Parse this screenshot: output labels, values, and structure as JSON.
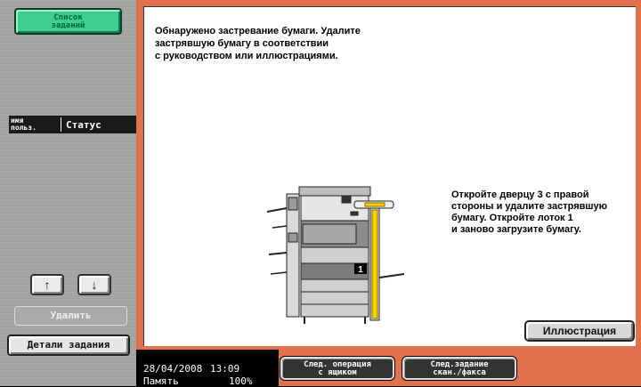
{
  "sidebar": {
    "job_list_label": "Список\nзаданий",
    "column_user": "имя\nпольз.",
    "column_status": "Статус",
    "up_arrow": "↑",
    "down_arrow": "↓",
    "delete_label": "Удалить",
    "details_label": "Детали задания"
  },
  "main": {
    "message": "Обнаружено застревание бумаги. Удалите\nзастрявшую бумагу в соответствии\nс руководством или иллюстрациями.",
    "instruction": "Откройте дверцу 3 с правой\nстороны и удалите застрявшую\nбумагу. Откройте лоток 1\nи заново загрузите бумагу.",
    "tray_marker": "1",
    "illustration_button": "Иллюстрация"
  },
  "status_bar": {
    "date": "28/04/2008",
    "time": "13:09",
    "memory_label": "Память",
    "memory_value": "100%",
    "box_operation_button": "След. операция\nс ящиком",
    "next_scan_fax_button": "След.задание\nскан./факса"
  },
  "colors": {
    "accent_orange": "#e2724e",
    "job_list_green": "#3ecf8f",
    "sidebar_gray": "#a9aaa9"
  }
}
